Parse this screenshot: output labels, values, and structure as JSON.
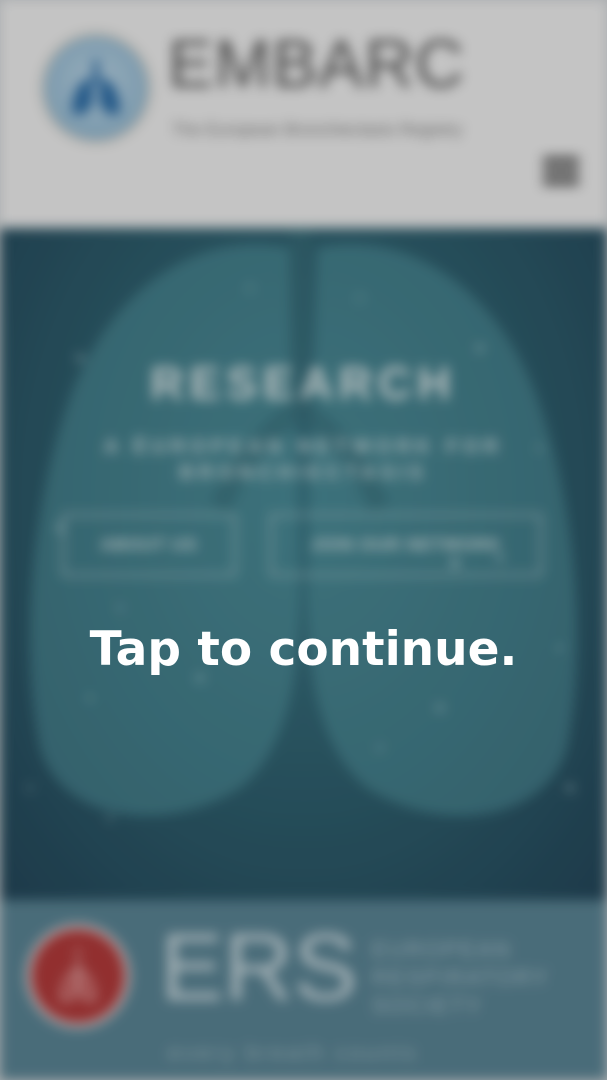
{
  "header": {
    "brand_title": "EMBARC",
    "brand_subtitle": "The European Bronchiectasis Registry",
    "logo_icon": "lungs-logo-icon",
    "menu_icon": "hamburger-menu-icon"
  },
  "hero": {
    "title": "RESEARCH",
    "subtitle": "A EUROPEAN NETWORK FOR BRONCHIECTASIS",
    "buttons": [
      {
        "label": "ABOUT US"
      },
      {
        "label": "JOIN OUR NETWORK"
      }
    ]
  },
  "footer": {
    "ers_mark": "ERS",
    "ers_name": "EUROPEAN RESPIRATORY SOCIETY",
    "ers_tagline": "every breath counts",
    "ers_logo_icon": "ers-seal-icon"
  },
  "overlay": {
    "prompt": "Tap to continue."
  },
  "colors": {
    "header_bg": "#efefef",
    "hero_bg": "#2e5e6d",
    "footer_bg": "#5a8494",
    "ers_red": "#b23a3a"
  }
}
